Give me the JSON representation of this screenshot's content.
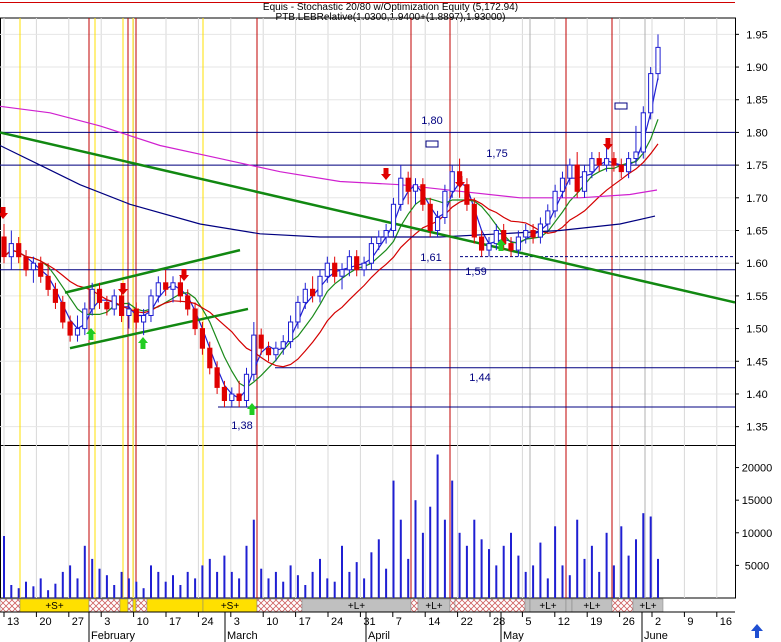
{
  "header": {
    "line1": "Equis - Stochastic 20/80 w/Optimization Equity (5,172.94)",
    "line2": "PTB.LEBRelative(1.0300,1.9400+(1.8897),1.93000)"
  },
  "colors": {
    "up_candle": "#1f1fd2",
    "down_candle": "#e00000",
    "volume": "#1f1fd2",
    "ma_fast": "#1f1fd2",
    "ma_mid": "#1a8a1a",
    "ma_slow": "#d40000",
    "ma_long": "#000080",
    "ma_magenta": "#d020d0",
    "trendline": "#118811",
    "hline": "#000080",
    "signal_red": "#e00000",
    "signal_yellow": "#ffe000",
    "signal_grey": "#c0c0c0",
    "arrow_buy": "#22cc22",
    "arrow_sell": "#e00000"
  },
  "chart_data": {
    "type": "candlestick",
    "price_axis": {
      "ticks": [
        "1.95",
        "1.90",
        "1.85",
        "1.80",
        "1.75",
        "1.70",
        "1.65",
        "1.60",
        "1.55",
        "1.50",
        "1.45",
        "1.40",
        "1.35"
      ],
      "range": [
        1.325,
        1.975
      ]
    },
    "volume_axis": {
      "ticks": [
        "20000",
        "15000",
        "10000",
        "5000"
      ],
      "range": [
        0,
        23000
      ]
    },
    "date_ticks": [
      "13",
      "20",
      "27",
      "3",
      "10",
      "17",
      "24",
      "3",
      "10",
      "17",
      "24",
      "31",
      "7",
      "14",
      "22",
      "28",
      "5",
      "12",
      "19",
      "26",
      "2",
      "9",
      "16"
    ],
    "month_labels": [
      "February",
      "March",
      "April",
      "May",
      "June"
    ],
    "bars": [
      {
        "o": 1.64,
        "h": 1.66,
        "l": 1.6,
        "c": 1.61,
        "v": 9500
      },
      {
        "o": 1.61,
        "h": 1.65,
        "l": 1.59,
        "c": 1.63,
        "v": 2000
      },
      {
        "o": 1.63,
        "h": 1.64,
        "l": 1.6,
        "c": 1.61,
        "v": 1500
      },
      {
        "o": 1.61,
        "h": 1.62,
        "l": 1.58,
        "c": 1.59,
        "v": 2500
      },
      {
        "o": 1.59,
        "h": 1.61,
        "l": 1.57,
        "c": 1.6,
        "v": 1800
      },
      {
        "o": 1.6,
        "h": 1.61,
        "l": 1.57,
        "c": 1.58,
        "v": 3000
      },
      {
        "o": 1.58,
        "h": 1.6,
        "l": 1.55,
        "c": 1.56,
        "v": 1200
      },
      {
        "o": 1.56,
        "h": 1.57,
        "l": 1.53,
        "c": 1.54,
        "v": 2200
      },
      {
        "o": 1.54,
        "h": 1.55,
        "l": 1.5,
        "c": 1.51,
        "v": 4000
      },
      {
        "o": 1.51,
        "h": 1.52,
        "l": 1.48,
        "c": 1.49,
        "v": 5000
      },
      {
        "o": 1.49,
        "h": 1.52,
        "l": 1.48,
        "c": 1.5,
        "v": 3000
      },
      {
        "o": 1.5,
        "h": 1.54,
        "l": 1.49,
        "c": 1.53,
        "v": 8000
      },
      {
        "o": 1.53,
        "h": 1.57,
        "l": 1.52,
        "c": 1.56,
        "v": 6000
      },
      {
        "o": 1.56,
        "h": 1.57,
        "l": 1.53,
        "c": 1.54,
        "v": 4500
      },
      {
        "o": 1.54,
        "h": 1.55,
        "l": 1.52,
        "c": 1.53,
        "v": 3500
      },
      {
        "o": 1.53,
        "h": 1.56,
        "l": 1.52,
        "c": 1.55,
        "v": 2000
      },
      {
        "o": 1.55,
        "h": 1.56,
        "l": 1.51,
        "c": 1.52,
        "v": 4000
      },
      {
        "o": 1.52,
        "h": 1.54,
        "l": 1.5,
        "c": 1.53,
        "v": 3000
      },
      {
        "o": 1.53,
        "h": 1.54,
        "l": 1.5,
        "c": 1.51,
        "v": 2500
      },
      {
        "o": 1.51,
        "h": 1.53,
        "l": 1.49,
        "c": 1.52,
        "v": 1500
      },
      {
        "o": 1.52,
        "h": 1.56,
        "l": 1.51,
        "c": 1.55,
        "v": 5000
      },
      {
        "o": 1.55,
        "h": 1.58,
        "l": 1.54,
        "c": 1.57,
        "v": 4000
      },
      {
        "o": 1.57,
        "h": 1.59,
        "l": 1.55,
        "c": 1.56,
        "v": 2500
      },
      {
        "o": 1.56,
        "h": 1.58,
        "l": 1.54,
        "c": 1.57,
        "v": 3500
      },
      {
        "o": 1.57,
        "h": 1.58,
        "l": 1.54,
        "c": 1.55,
        "v": 2000
      },
      {
        "o": 1.55,
        "h": 1.56,
        "l": 1.52,
        "c": 1.53,
        "v": 4000
      },
      {
        "o": 1.53,
        "h": 1.54,
        "l": 1.49,
        "c": 1.5,
        "v": 3000
      },
      {
        "o": 1.5,
        "h": 1.51,
        "l": 1.46,
        "c": 1.47,
        "v": 5000
      },
      {
        "o": 1.47,
        "h": 1.48,
        "l": 1.43,
        "c": 1.44,
        "v": 6000
      },
      {
        "o": 1.44,
        "h": 1.45,
        "l": 1.4,
        "c": 1.41,
        "v": 4000
      },
      {
        "o": 1.41,
        "h": 1.42,
        "l": 1.38,
        "c": 1.39,
        "v": 6500
      },
      {
        "o": 1.39,
        "h": 1.41,
        "l": 1.38,
        "c": 1.4,
        "v": 4000
      },
      {
        "o": 1.4,
        "h": 1.42,
        "l": 1.38,
        "c": 1.39,
        "v": 3000
      },
      {
        "o": 1.39,
        "h": 1.44,
        "l": 1.38,
        "c": 1.43,
        "v": 8000
      },
      {
        "o": 1.43,
        "h": 1.51,
        "l": 1.42,
        "c": 1.49,
        "v": 12000
      },
      {
        "o": 1.49,
        "h": 1.5,
        "l": 1.46,
        "c": 1.47,
        "v": 4500
      },
      {
        "o": 1.47,
        "h": 1.48,
        "l": 1.45,
        "c": 1.46,
        "v": 3000
      },
      {
        "o": 1.46,
        "h": 1.48,
        "l": 1.45,
        "c": 1.47,
        "v": 4000
      },
      {
        "o": 1.47,
        "h": 1.49,
        "l": 1.46,
        "c": 1.48,
        "v": 2500
      },
      {
        "o": 1.48,
        "h": 1.52,
        "l": 1.47,
        "c": 1.51,
        "v": 5000
      },
      {
        "o": 1.51,
        "h": 1.55,
        "l": 1.5,
        "c": 1.54,
        "v": 3500
      },
      {
        "o": 1.54,
        "h": 1.57,
        "l": 1.53,
        "c": 1.56,
        "v": 2000
      },
      {
        "o": 1.56,
        "h": 1.58,
        "l": 1.54,
        "c": 1.55,
        "v": 4000
      },
      {
        "o": 1.55,
        "h": 1.59,
        "l": 1.54,
        "c": 1.58,
        "v": 6000
      },
      {
        "o": 1.58,
        "h": 1.61,
        "l": 1.57,
        "c": 1.6,
        "v": 3000
      },
      {
        "o": 1.6,
        "h": 1.61,
        "l": 1.57,
        "c": 1.58,
        "v": 2500
      },
      {
        "o": 1.58,
        "h": 1.6,
        "l": 1.56,
        "c": 1.59,
        "v": 8000
      },
      {
        "o": 1.59,
        "h": 1.62,
        "l": 1.58,
        "c": 1.61,
        "v": 4000
      },
      {
        "o": 1.61,
        "h": 1.62,
        "l": 1.58,
        "c": 1.59,
        "v": 5500
      },
      {
        "o": 1.59,
        "h": 1.61,
        "l": 1.58,
        "c": 1.6,
        "v": 3000
      },
      {
        "o": 1.6,
        "h": 1.64,
        "l": 1.59,
        "c": 1.63,
        "v": 7000
      },
      {
        "o": 1.63,
        "h": 1.65,
        "l": 1.62,
        "c": 1.64,
        "v": 9000
      },
      {
        "o": 1.64,
        "h": 1.66,
        "l": 1.63,
        "c": 1.65,
        "v": 4500
      },
      {
        "o": 1.65,
        "h": 1.7,
        "l": 1.64,
        "c": 1.69,
        "v": 18000
      },
      {
        "o": 1.69,
        "h": 1.75,
        "l": 1.68,
        "c": 1.73,
        "v": 12000
      },
      {
        "o": 1.73,
        "h": 1.74,
        "l": 1.69,
        "c": 1.71,
        "v": 6000
      },
      {
        "o": 1.71,
        "h": 1.73,
        "l": 1.69,
        "c": 1.72,
        "v": 15000
      },
      {
        "o": 1.72,
        "h": 1.73,
        "l": 1.68,
        "c": 1.69,
        "v": 10000
      },
      {
        "o": 1.69,
        "h": 1.7,
        "l": 1.64,
        "c": 1.65,
        "v": 14000
      },
      {
        "o": 1.65,
        "h": 1.68,
        "l": 1.64,
        "c": 1.67,
        "v": 22000
      },
      {
        "o": 1.67,
        "h": 1.72,
        "l": 1.66,
        "c": 1.71,
        "v": 12000
      },
      {
        "o": 1.71,
        "h": 1.75,
        "l": 1.7,
        "c": 1.74,
        "v": 18000
      },
      {
        "o": 1.74,
        "h": 1.76,
        "l": 1.7,
        "c": 1.72,
        "v": 10000
      },
      {
        "o": 1.72,
        "h": 1.73,
        "l": 1.68,
        "c": 1.69,
        "v": 8000
      },
      {
        "o": 1.69,
        "h": 1.7,
        "l": 1.63,
        "c": 1.64,
        "v": 12000
      },
      {
        "o": 1.64,
        "h": 1.65,
        "l": 1.61,
        "c": 1.62,
        "v": 9000
      },
      {
        "o": 1.62,
        "h": 1.64,
        "l": 1.61,
        "c": 1.63,
        "v": 7500
      },
      {
        "o": 1.63,
        "h": 1.66,
        "l": 1.62,
        "c": 1.65,
        "v": 5000
      },
      {
        "o": 1.65,
        "h": 1.66,
        "l": 1.62,
        "c": 1.63,
        "v": 8000
      },
      {
        "o": 1.63,
        "h": 1.64,
        "l": 1.61,
        "c": 1.62,
        "v": 10000
      },
      {
        "o": 1.62,
        "h": 1.65,
        "l": 1.61,
        "c": 1.64,
        "v": 6500
      },
      {
        "o": 1.64,
        "h": 1.66,
        "l": 1.63,
        "c": 1.65,
        "v": 4000
      },
      {
        "o": 1.65,
        "h": 1.66,
        "l": 1.63,
        "c": 1.64,
        "v": 5000
      },
      {
        "o": 1.64,
        "h": 1.67,
        "l": 1.63,
        "c": 1.66,
        "v": 8500
      },
      {
        "o": 1.66,
        "h": 1.69,
        "l": 1.65,
        "c": 1.68,
        "v": 3000
      },
      {
        "o": 1.68,
        "h": 1.72,
        "l": 1.67,
        "c": 1.71,
        "v": 11000
      },
      {
        "o": 1.71,
        "h": 1.74,
        "l": 1.7,
        "c": 1.73,
        "v": 5000
      },
      {
        "o": 1.73,
        "h": 1.76,
        "l": 1.72,
        "c": 1.75,
        "v": 3500
      },
      {
        "o": 1.75,
        "h": 1.77,
        "l": 1.7,
        "c": 1.71,
        "v": 12000
      },
      {
        "o": 1.71,
        "h": 1.75,
        "l": 1.7,
        "c": 1.74,
        "v": 6000
      },
      {
        "o": 1.74,
        "h": 1.77,
        "l": 1.73,
        "c": 1.76,
        "v": 8000
      },
      {
        "o": 1.76,
        "h": 1.77,
        "l": 1.74,
        "c": 1.75,
        "v": 4000
      },
      {
        "o": 1.75,
        "h": 1.78,
        "l": 1.74,
        "c": 1.76,
        "v": 10000
      },
      {
        "o": 1.76,
        "h": 1.77,
        "l": 1.74,
        "c": 1.75,
        "v": 5000
      },
      {
        "o": 1.75,
        "h": 1.76,
        "l": 1.73,
        "c": 1.74,
        "v": 11000
      },
      {
        "o": 1.74,
        "h": 1.77,
        "l": 1.73,
        "c": 1.76,
        "v": 6500
      },
      {
        "o": 1.76,
        "h": 1.81,
        "l": 1.75,
        "c": 1.77,
        "v": 9000
      },
      {
        "o": 1.77,
        "h": 1.84,
        "l": 1.76,
        "c": 1.83,
        "v": 13000
      },
      {
        "o": 1.83,
        "h": 1.9,
        "l": 1.82,
        "c": 1.89,
        "v": 12500
      },
      {
        "o": 1.89,
        "h": 1.95,
        "l": 1.88,
        "c": 1.93,
        "v": 6000
      }
    ],
    "annotations": [
      {
        "text": "1,80",
        "price": 1.8
      },
      {
        "text": "1,75",
        "price": 1.75
      },
      {
        "text": "1,61",
        "price": 1.61
      },
      {
        "text": "1,59",
        "price": 1.59
      },
      {
        "text": "1,44",
        "price": 1.44
      },
      {
        "text": "1,38",
        "price": 1.38
      }
    ],
    "signal_bar": [
      {
        "label": "",
        "kind": "red"
      },
      {
        "label": "+S+",
        "kind": "yellow"
      },
      {
        "label": "",
        "kind": "red"
      },
      {
        "label": "",
        "kind": "yellow"
      },
      {
        "label": "",
        "kind": "red"
      },
      {
        "label": "",
        "kind": "yellow"
      },
      {
        "label": "",
        "kind": "red"
      },
      {
        "label": "+S+",
        "kind": "yellow"
      },
      {
        "label": "",
        "kind": "red"
      },
      {
        "label": "+L+",
        "kind": "grey"
      },
      {
        "label": "",
        "kind": "red"
      },
      {
        "label": "+L+",
        "kind": "grey"
      },
      {
        "label": "",
        "kind": "red"
      },
      {
        "label": "",
        "kind": "grey"
      },
      {
        "label": "+L+",
        "kind": "grey"
      },
      {
        "label": "",
        "kind": "red"
      },
      {
        "label": "+L+",
        "kind": "grey"
      },
      {
        "label": "",
        "kind": "red"
      },
      {
        "label": "+L+",
        "kind": "grey"
      }
    ],
    "grid": true
  }
}
